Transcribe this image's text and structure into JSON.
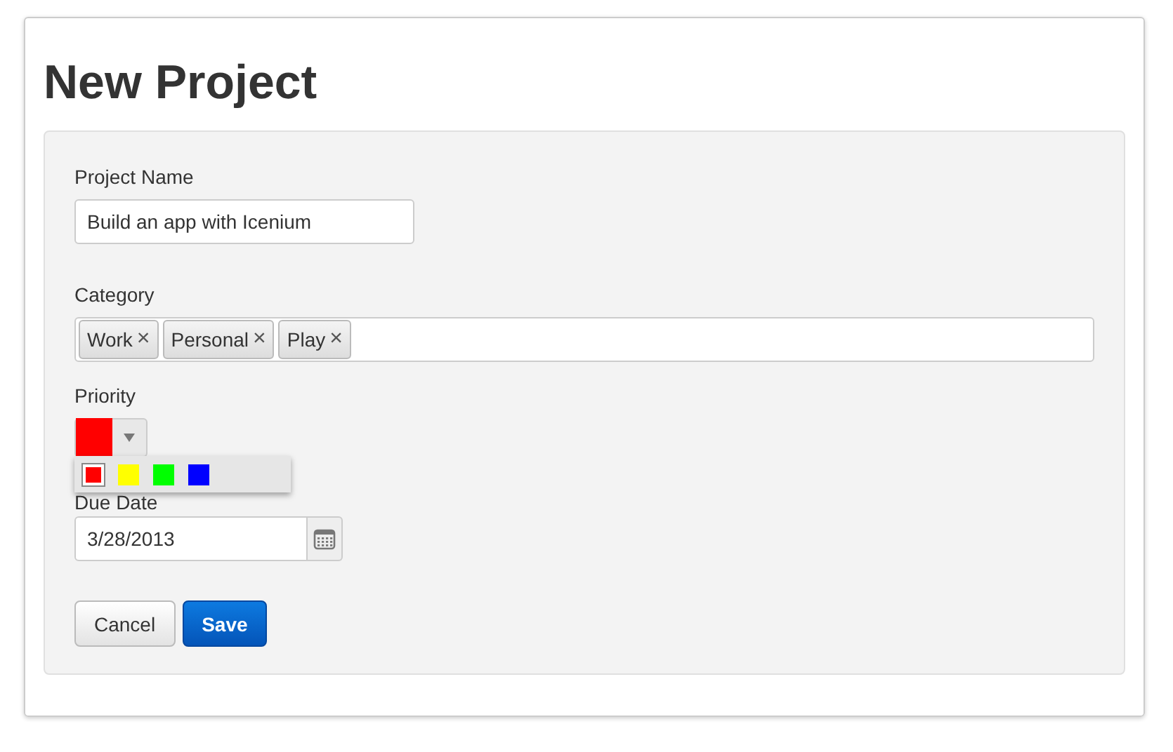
{
  "title": "New Project",
  "project_name": {
    "label": "Project Name",
    "value": "Build an app with Icenium"
  },
  "category": {
    "label": "Category",
    "tags": [
      {
        "label": "Work",
        "remove": "×"
      },
      {
        "label": "Personal",
        "remove": "×"
      },
      {
        "label": "Play",
        "remove": "×"
      }
    ]
  },
  "priority": {
    "label": "Priority",
    "expanded": true,
    "colors": [
      {
        "color": "#ff0000",
        "selected": true
      },
      {
        "color": "#ffff00",
        "selected": false
      },
      {
        "color": "#00ff00",
        "selected": false
      },
      {
        "color": "#0000ff",
        "selected": false
      }
    ]
  },
  "due_date": {
    "label": "Due Date",
    "value": "3/28/2013"
  },
  "buttons": [
    {
      "label": "Cancel",
      "kind": "secondary"
    },
    {
      "label": "Save",
      "kind": "primary"
    }
  ]
}
